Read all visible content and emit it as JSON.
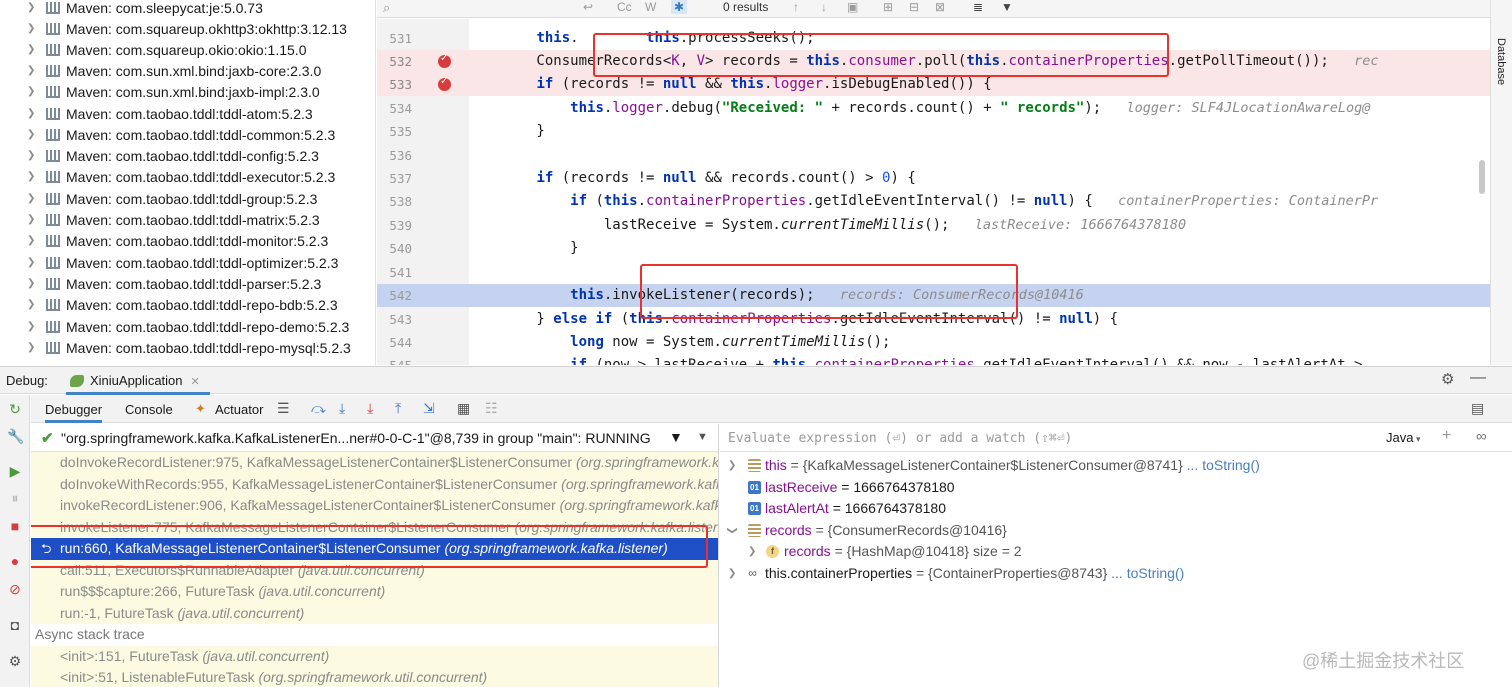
{
  "project_tree": {
    "items": [
      "Maven: com.sleepycat:je:5.0.73",
      "Maven: com.squareup.okhttp3:okhttp:3.12.13",
      "Maven: com.squareup.okio:okio:1.15.0",
      "Maven: com.sun.xml.bind:jaxb-core:2.3.0",
      "Maven: com.sun.xml.bind:jaxb-impl:2.3.0",
      "Maven: com.taobao.tddl:tddl-atom:5.2.3",
      "Maven: com.taobao.tddl:tddl-common:5.2.3",
      "Maven: com.taobao.tddl:tddl-config:5.2.3",
      "Maven: com.taobao.tddl:tddl-executor:5.2.3",
      "Maven: com.taobao.tddl:tddl-group:5.2.3",
      "Maven: com.taobao.tddl:tddl-matrix:5.2.3",
      "Maven: com.taobao.tddl:tddl-monitor:5.2.3",
      "Maven: com.taobao.tddl:tddl-optimizer:5.2.3",
      "Maven: com.taobao.tddl:tddl-parser:5.2.3",
      "Maven: com.taobao.tddl:tddl-repo-bdb:5.2.3",
      "Maven: com.taobao.tddl:tddl-repo-demo:5.2.3",
      "Maven: com.taobao.tddl:tddl-repo-mysql:5.2.3"
    ]
  },
  "find_bar": {
    "cc": "Cc",
    "w": "W",
    "results": "0 results"
  },
  "editor": {
    "lines": [
      {
        "n": "531",
        "code": "this.processSeeks();"
      },
      {
        "n": "532",
        "code": "ConsumerRecords<K, V> records = this.consumer.poll(this.containerProperties.getPollTimeout());",
        "hint": "rec"
      },
      {
        "n": "533",
        "code": "if (records != null && this.logger.isDebugEnabled()) {"
      },
      {
        "n": "534",
        "code": "this.logger.debug(\"Received: \" + records.count() + \" records\");",
        "hint": "logger: SLF4JLocationAwareLog@"
      },
      {
        "n": "535",
        "code": "}"
      },
      {
        "n": "536",
        "code": ""
      },
      {
        "n": "537",
        "code": "if (records != null && records.count() > 0) {"
      },
      {
        "n": "538",
        "code": "if (this.containerProperties.getIdleEventInterval() != null) {",
        "hint": "containerProperties: ContainerPr"
      },
      {
        "n": "539",
        "code": "lastReceive = System.currentTimeMillis();",
        "hint": "lastReceive: 1666764378180"
      },
      {
        "n": "540",
        "code": "}"
      },
      {
        "n": "541",
        "code": ""
      },
      {
        "n": "542",
        "code": "this.invokeListener(records);",
        "hint": "records: ConsumerRecords@10416"
      },
      {
        "n": "543",
        "code": "} else if (this.containerProperties.getIdleEventInterval() != null) {"
      },
      {
        "n": "544",
        "code": "long now = System.currentTimeMillis();"
      },
      {
        "n": "545",
        "code": "if (now > lastReceive + this.containerProperties.getIdleEventInterval() && now - lastAlertAt >"
      }
    ]
  },
  "right_strip": {
    "label": "Database"
  },
  "debug": {
    "label": "Debug:",
    "app_tab": "XiniuApplication",
    "tabs": [
      "Debugger",
      "Console",
      "Actuator"
    ],
    "thread": "\"org.springframework.kafka.KafkaListenerEn...ner#0-0-C-1\"@8,739 in group \"main\": RUNNING",
    "frames": [
      {
        "method": "doInvokeRecordListener:975, KafkaMessageListenerContainer$ListenerConsumer",
        "pkg": "(org.springframework.kafka.listener)"
      },
      {
        "method": "doInvokeWithRecords:955, KafkaMessageListenerContainer$ListenerConsumer",
        "pkg": "(org.springframework.kafka.listener)"
      },
      {
        "method": "invokeRecordListener:906, KafkaMessageListenerContainer$ListenerConsumer",
        "pkg": "(org.springframework.kafka.listener)"
      },
      {
        "method": "invokeListener:775, KafkaMessageListenerContainer$ListenerConsumer",
        "pkg": "(org.springframework.kafka.listener)"
      },
      {
        "method": "run:660, KafkaMessageListenerContainer$ListenerConsumer",
        "pkg": "(org.springframework.kafka.listener)"
      },
      {
        "method": "call:511, Executors$RunnableAdapter",
        "pkg": "(java.util.concurrent)"
      },
      {
        "method": "run$$$capture:266, FutureTask",
        "pkg": "(java.util.concurrent)"
      },
      {
        "method": "run:-1, FutureTask",
        "pkg": "(java.util.concurrent)"
      }
    ],
    "async_label": "Async stack trace",
    "async_frames": [
      {
        "method": "<init>:151, FutureTask",
        "pkg": "(java.util.concurrent)"
      },
      {
        "method": "<init>:51, ListenableFutureTask",
        "pkg": "(org.springframework.util.concurrent)"
      }
    ],
    "eval_placeholder": "Evaluate expression (⏎) or add a watch (⇧⌘⏎)",
    "lang": "Java",
    "vars": [
      {
        "name": "this",
        "value": " = {KafkaMessageListenerContainer$ListenerConsumer@8741}",
        "link": " ... toString()"
      },
      {
        "name": "lastReceive",
        "value": " = 1666764378180",
        "link": ""
      },
      {
        "name": "lastAlertAt",
        "value": " = 1666764378180",
        "link": ""
      },
      {
        "name": "records",
        "value": " = {ConsumerRecords@10416}",
        "link": ""
      },
      {
        "name": "records",
        "value": " = {HashMap@10418}  size = 2",
        "link": ""
      },
      {
        "name": "this.containerProperties",
        "value": " = {ContainerProperties@8743}",
        "link": " ... toString()"
      }
    ]
  },
  "watermark": "@稀土掘金技术社区"
}
